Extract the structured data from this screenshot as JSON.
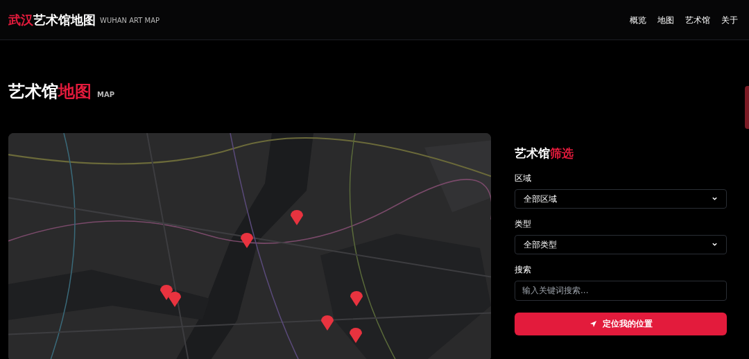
{
  "header": {
    "logo": [
      {
        "text": "武汉",
        "accent": true
      },
      {
        "text": "艺术馆地图",
        "accent": false
      }
    ],
    "subtitle": "WUHAN ART MAP",
    "nav": [
      "概览",
      "地图",
      "艺术馆",
      "关于"
    ]
  },
  "section": {
    "title": [
      {
        "text": "艺术馆",
        "accent": false
      },
      {
        "text": "地图",
        "accent": true
      }
    ],
    "tag": "MAP"
  },
  "filters": {
    "title": [
      {
        "text": "艺术馆",
        "accent": false
      },
      {
        "text": "筛选",
        "accent": true
      }
    ],
    "fields": [
      {
        "kind": "select",
        "label": "区域",
        "value": "全部区域"
      },
      {
        "kind": "select",
        "label": "类型",
        "value": "全部类型"
      },
      {
        "kind": "input",
        "label": "搜索",
        "placeholder": "输入关键词搜索..."
      }
    ],
    "button": "定位我的位置"
  }
}
